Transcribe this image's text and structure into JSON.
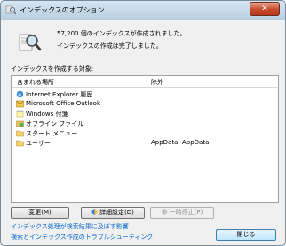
{
  "window": {
    "title": "インデックスのオプション"
  },
  "status": {
    "count_text": "57,200 個のインデックスが作成されました。",
    "done_text": "インデックスの作成は完了しました。"
  },
  "locations": {
    "group_label": "インデックスを作成する対象:",
    "col_included": "含まれる場所",
    "col_excluded": "除外",
    "rows": [
      {
        "name": "Internet Explorer 履歴",
        "exclude": "",
        "icon": "ie-history-icon"
      },
      {
        "name": "Microsoft Office Outlook",
        "exclude": "",
        "icon": "outlook-icon"
      },
      {
        "name": "Windows 付箋",
        "exclude": "",
        "icon": "sticky-notes-icon"
      },
      {
        "name": "オフライン ファイル",
        "exclude": "",
        "icon": "offline-files-icon"
      },
      {
        "name": "スタート メニュー",
        "exclude": "",
        "icon": "folder-icon"
      },
      {
        "name": "ユーザー",
        "exclude": "AppData; AppData",
        "icon": "folder-icon"
      }
    ]
  },
  "buttons": {
    "modify": "変更(M)",
    "advanced": "詳細設定(D)",
    "pause": "一時停止(P)",
    "close": "閉じる"
  },
  "links": {
    "affect": "インデックス処理が検索結果に及ぼす影響",
    "troubleshoot": "検索とインデックス作成のトラブルシューティング"
  }
}
